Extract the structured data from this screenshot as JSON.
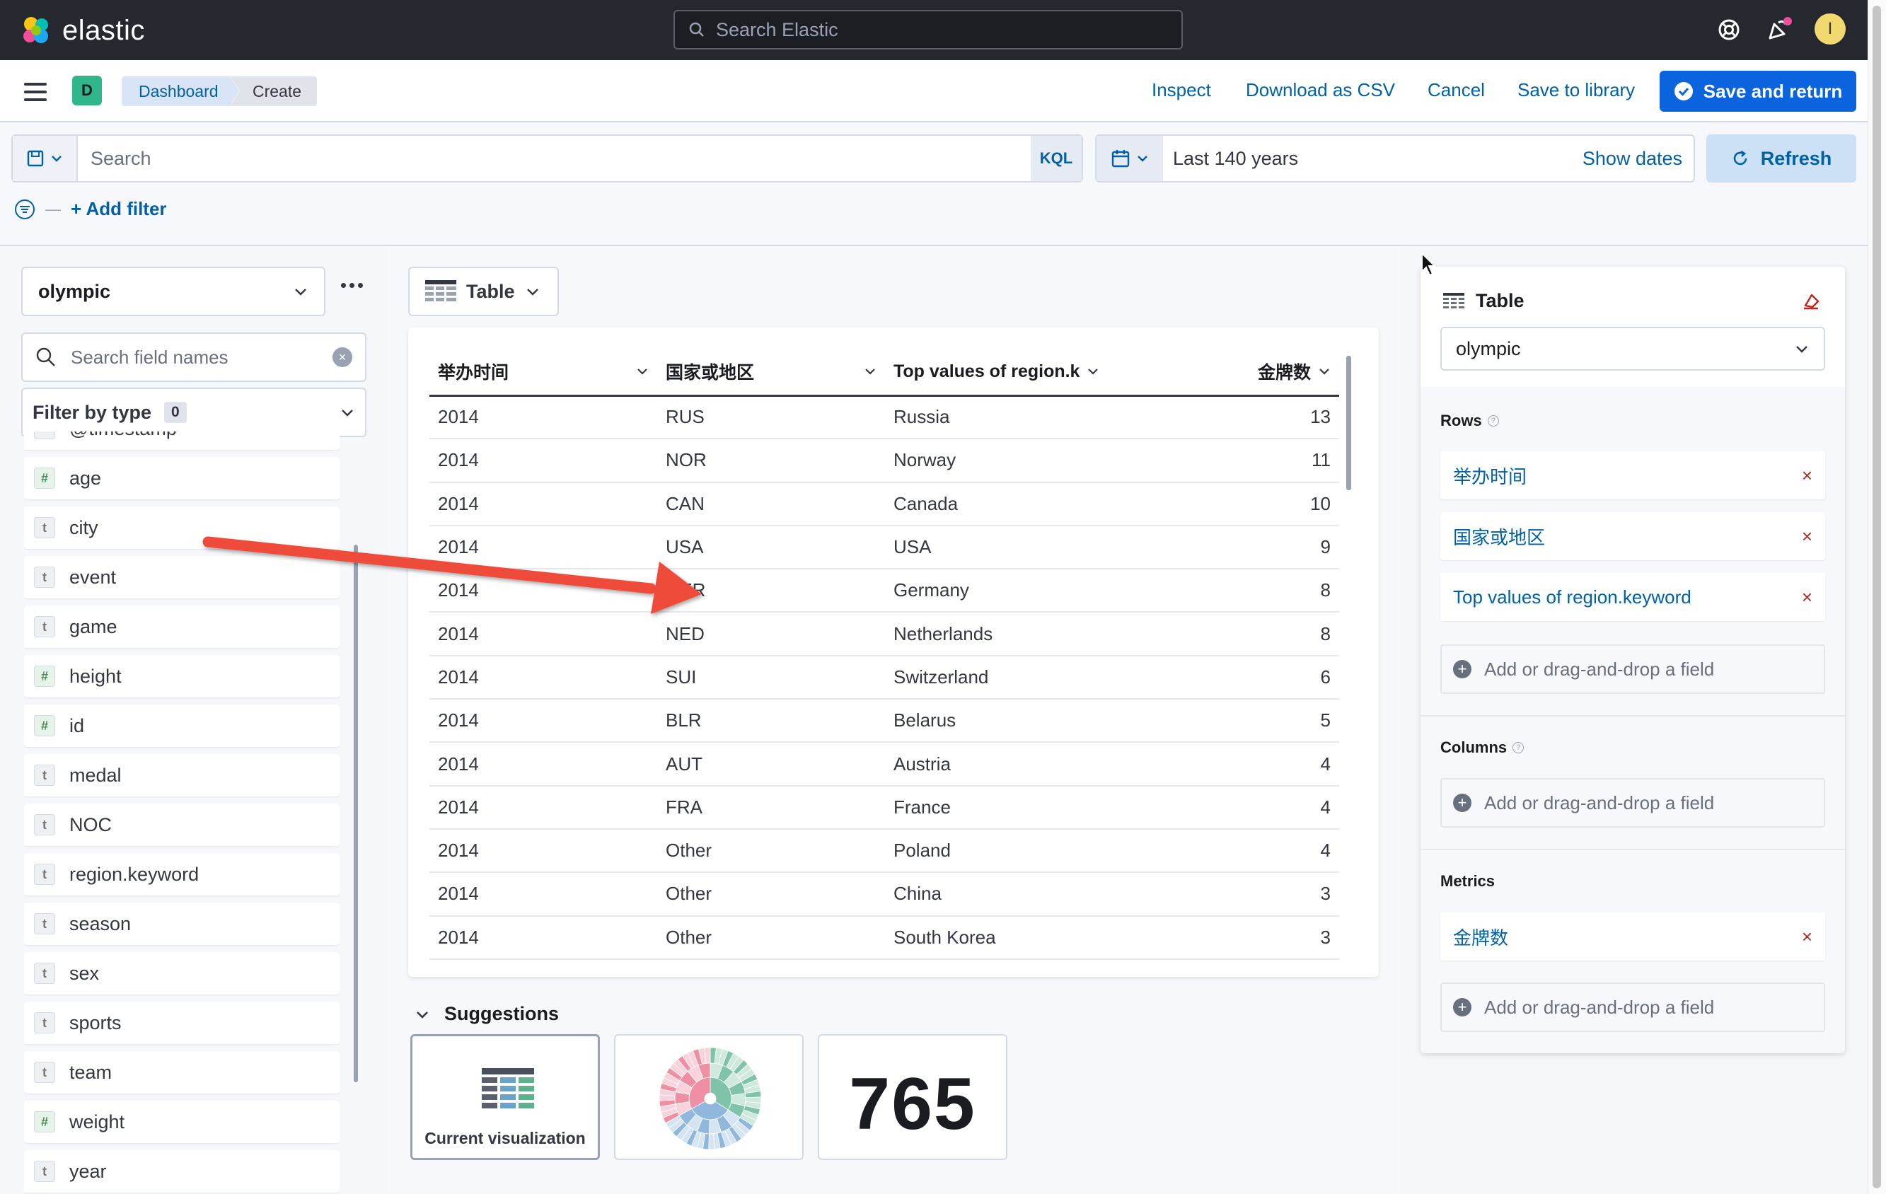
{
  "header": {
    "logo_text": "elastic",
    "search_placeholder": "Search Elastic",
    "avatar_initial": "I",
    "notification_color": "#f04e98"
  },
  "nav": {
    "space_initial": "D",
    "breadcrumbs": [
      "Dashboard",
      "Create"
    ],
    "links": {
      "inspect": "Inspect",
      "download_csv": "Download as CSV",
      "cancel": "Cancel",
      "save_library": "Save to library",
      "save_return": "Save and return"
    }
  },
  "query": {
    "placeholder": "Search",
    "language": "KQL",
    "time_range": "Last 140 years",
    "show_dates": "Show dates",
    "refresh": "Refresh",
    "add_filter": "+ Add filter"
  },
  "fields": {
    "index_pattern": "olympic",
    "search_placeholder": "Search field names",
    "filter_by_type": "Filter by type",
    "filter_count": "0",
    "items": [
      {
        "name": "@timestamp",
        "type": "date"
      },
      {
        "name": "age",
        "type": "#"
      },
      {
        "name": "city",
        "type": "t"
      },
      {
        "name": "event",
        "type": "t"
      },
      {
        "name": "game",
        "type": "t"
      },
      {
        "name": "height",
        "type": "#"
      },
      {
        "name": "id",
        "type": "#"
      },
      {
        "name": "medal",
        "type": "t"
      },
      {
        "name": "NOC",
        "type": "t"
      },
      {
        "name": "region.keyword",
        "type": "t"
      },
      {
        "name": "season",
        "type": "t"
      },
      {
        "name": "sex",
        "type": "t"
      },
      {
        "name": "sports",
        "type": "t"
      },
      {
        "name": "team",
        "type": "t"
      },
      {
        "name": "weight",
        "type": "#"
      },
      {
        "name": "year",
        "type": "t"
      }
    ]
  },
  "workspace": {
    "chart_type": "Table",
    "table": {
      "columns": [
        "举办时间",
        "国家或地区",
        "Top values of region.k",
        "金牌数"
      ],
      "rows": [
        [
          "2014",
          "RUS",
          "Russia",
          "13"
        ],
        [
          "2014",
          "NOR",
          "Norway",
          "11"
        ],
        [
          "2014",
          "CAN",
          "Canada",
          "10"
        ],
        [
          "2014",
          "USA",
          "USA",
          "9"
        ],
        [
          "2014",
          "GER",
          "Germany",
          "8"
        ],
        [
          "2014",
          "NED",
          "Netherlands",
          "8"
        ],
        [
          "2014",
          "SUI",
          "Switzerland",
          "6"
        ],
        [
          "2014",
          "BLR",
          "Belarus",
          "5"
        ],
        [
          "2014",
          "AUT",
          "Austria",
          "4"
        ],
        [
          "2014",
          "FRA",
          "France",
          "4"
        ],
        [
          "2014",
          "Other",
          "Poland",
          "4"
        ],
        [
          "2014",
          "Other",
          "China",
          "3"
        ],
        [
          "2014",
          "Other",
          "South Korea",
          "3"
        ]
      ]
    },
    "suggestions": {
      "title": "Suggestions",
      "current_label": "Current visualization",
      "metric_value": "765"
    }
  },
  "config": {
    "title": "Table",
    "layer_index": "olympic",
    "rows_title": "Rows",
    "rows": [
      "举办时间",
      "国家或地区",
      "Top values of region.keyword"
    ],
    "columns_title": "Columns",
    "metrics_title": "Metrics",
    "metrics": [
      "金牌数"
    ],
    "add_field": "Add or drag-and-drop a field"
  }
}
